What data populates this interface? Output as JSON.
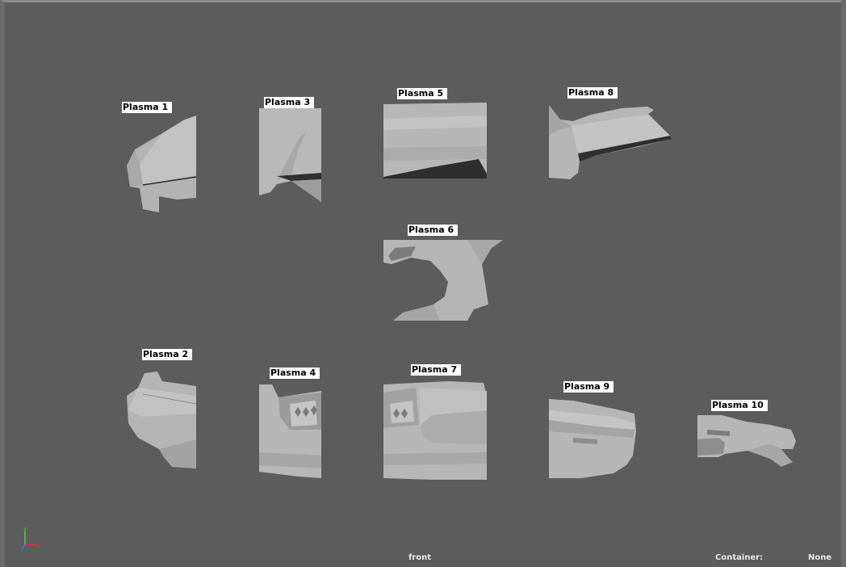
{
  "viewport": {
    "camera": "front",
    "container_label": "Container:",
    "container_value": "None"
  },
  "axis": {
    "x_label": "x",
    "y_label": "y",
    "z_label": "z"
  },
  "pieces": [
    {
      "id": "plasma-1",
      "label": "Plasma 1"
    },
    {
      "id": "plasma-2",
      "label": "Plasma 2"
    },
    {
      "id": "plasma-3",
      "label": "Plasma 3"
    },
    {
      "id": "plasma-4",
      "label": "Plasma 4"
    },
    {
      "id": "plasma-5",
      "label": "Plasma 5"
    },
    {
      "id": "plasma-6",
      "label": "Plasma 6"
    },
    {
      "id": "plasma-7",
      "label": "Plasma 7"
    },
    {
      "id": "plasma-8",
      "label": "Plasma 8"
    },
    {
      "id": "plasma-9",
      "label": "Plasma 9"
    },
    {
      "id": "plasma-10",
      "label": "Plasma 10"
    }
  ],
  "colors": {
    "background": "#5c5c5c",
    "mesh_light": "#b5b5b5",
    "mesh_dark": "#8f8f8f",
    "label_bg": "#ffffff"
  }
}
